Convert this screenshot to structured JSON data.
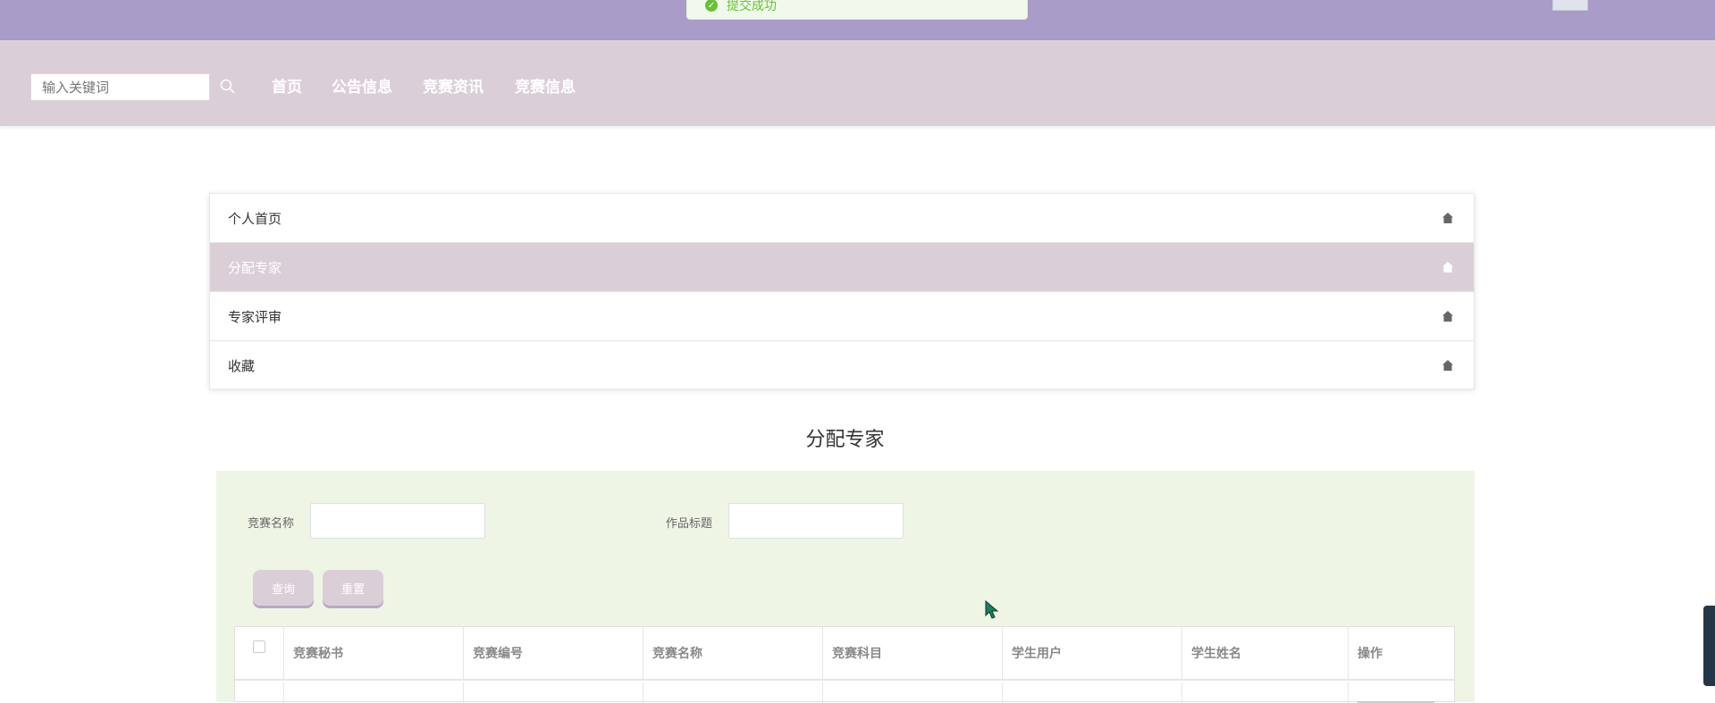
{
  "toast": {
    "message": "提交成功"
  },
  "navbar": {
    "search_placeholder": "输入关键词",
    "links": [
      "首页",
      "公告信息",
      "竞赛资讯",
      "竞赛信息"
    ]
  },
  "side_menu": {
    "items": [
      {
        "label": "个人首页",
        "active": false
      },
      {
        "label": "分配专家",
        "active": true
      },
      {
        "label": "专家评审",
        "active": false
      },
      {
        "label": "收藏",
        "active": false
      }
    ]
  },
  "page": {
    "title": "分配专家"
  },
  "filter": {
    "competition_name_label": "竞赛名称",
    "work_title_label": "作品标题",
    "query_button": "查询",
    "reset_button": "重置"
  },
  "table": {
    "columns": [
      "竞赛秘书",
      "竞赛编号",
      "竞赛名称",
      "竞赛科目",
      "学生用户",
      "学生姓名",
      "操作"
    ]
  },
  "colors": {
    "topbar": "#a99cc8",
    "navbar": "#dbcfd7",
    "panel": "#eef5e5",
    "accent": "#b6a9c4"
  }
}
